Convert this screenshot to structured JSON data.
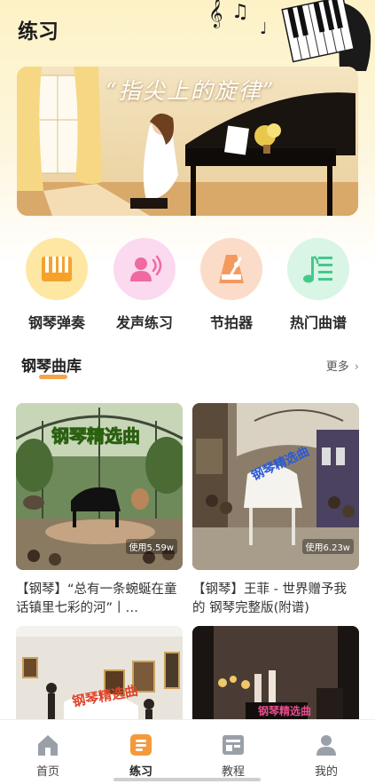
{
  "header": {
    "title": "练习"
  },
  "banner": {
    "title": "“指尖上的旋律”"
  },
  "features": [
    {
      "label": "钢琴弹奏",
      "icon": "piano-keys-icon",
      "color": "#fde7a3"
    },
    {
      "label": "发声练习",
      "icon": "voice-icon",
      "color": "#fbd9ef"
    },
    {
      "label": "节拍器",
      "icon": "metronome-icon",
      "color": "#fbdcc8"
    },
    {
      "label": "热门曲谱",
      "icon": "sheet-music-icon",
      "color": "#d8f5e6"
    }
  ],
  "library": {
    "title": "钢琴曲库",
    "more_label": "更多",
    "cards": [
      {
        "overlay_text": "钢琴精选曲",
        "usage": "使用5.59w",
        "desc": "【钢琴】“总有一条蜿蜒在童话镇里七彩的河”丨…"
      },
      {
        "overlay_text": "钢琴精选曲",
        "usage": "使用6.23w",
        "desc": "【钢琴】王菲 - 世界赠予我的 钢琴完整版(附谱)"
      },
      {
        "overlay_text": "钢琴精选曲",
        "usage": "",
        "desc": ""
      },
      {
        "overlay_text": "钢琴精选曲",
        "usage": "",
        "desc": ""
      }
    ]
  },
  "tabbar": {
    "items": [
      {
        "label": "首页",
        "icon": "home-icon"
      },
      {
        "label": "练习",
        "icon": "practice-icon",
        "active": true
      },
      {
        "label": "教程",
        "icon": "tutorial-icon"
      },
      {
        "label": "我的",
        "icon": "profile-icon"
      }
    ]
  },
  "colors": {
    "accent": "#f6a54a",
    "tab_active": "#f39a3a"
  }
}
